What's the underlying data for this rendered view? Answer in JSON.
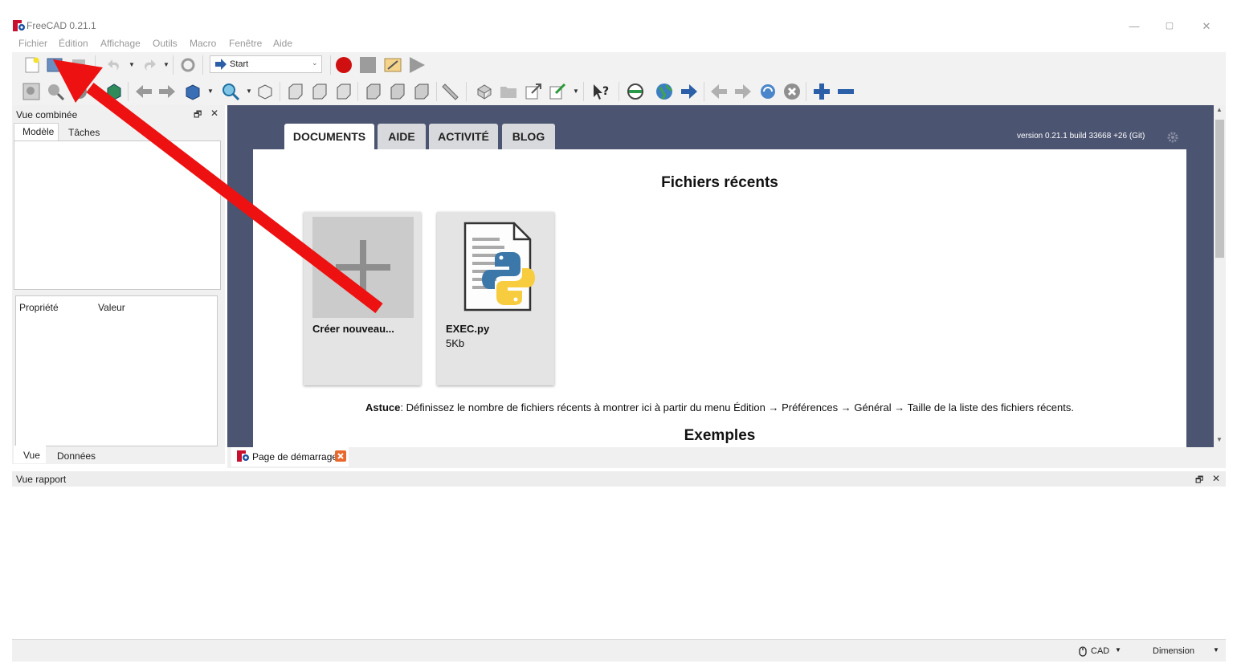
{
  "window": {
    "title": "FreeCAD 0.21.1",
    "minimize": "—",
    "restore": "▢",
    "close": "✕"
  },
  "menu": [
    "Fichier",
    "Édition",
    "Affichage",
    "Outils",
    "Macro",
    "Fenêtre",
    "Aide"
  ],
  "toolbar": {
    "workbench": "Start"
  },
  "combo_view": {
    "title": "Vue combinée",
    "tabs": [
      "Modèle",
      "Tâches"
    ],
    "property_headers": [
      "Propriété",
      "Valeur"
    ],
    "bottom_tabs": [
      "Vue",
      "Données"
    ]
  },
  "start_page": {
    "tabs": [
      "DOCUMENTS",
      "AIDE",
      "ACTIVITÉ",
      "BLOG"
    ],
    "version": "version 0.21.1 build 33668 +26 (Git)",
    "recent_heading": "Fichiers récents",
    "cards": [
      {
        "label": "Créer nouveau...",
        "sub": ""
      },
      {
        "label": "EXEC.py",
        "sub": "5Kb"
      }
    ],
    "tip_bold": "Astuce",
    "tip_text": ": Définissez le nombre de fichiers récents à montrer ici à partir du menu Édition → Préférences → Général → Taille de la liste des fichiers récents.",
    "examples_heading": "Exemples"
  },
  "doc_tab": {
    "label": "Page de démarrage"
  },
  "report_view": {
    "title": "Vue rapport"
  },
  "statusbar": {
    "nav_style": "CAD",
    "units": "Dimension"
  },
  "colors": {
    "arrow": "#ee1111",
    "panel_bg": "#4b5471"
  }
}
